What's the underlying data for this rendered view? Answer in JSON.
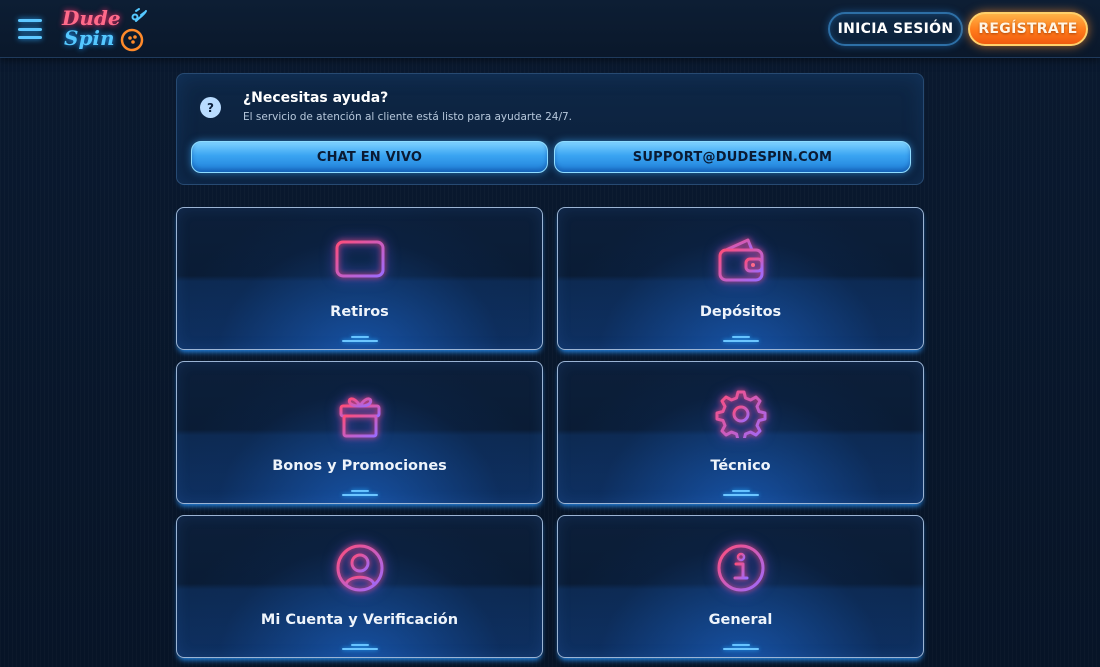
{
  "header": {
    "menu_icon": "hamburger-menu-icon",
    "logo": {
      "line1": "Dude",
      "line2": "Spin"
    },
    "login_label": "INICIA SESIÓN",
    "register_label": "REGÍSTRATE"
  },
  "help": {
    "icon": "question-icon",
    "title": "¿Necesitas ayuda?",
    "subtitle": "El servicio de atención al cliente está listo para ayudarte 24/7.",
    "chat_label": "CHAT EN VIVO",
    "email_label": "SUPPORT@DUDESPIN.COM"
  },
  "categories": [
    {
      "label": "Retiros",
      "icon": "credit-card-icon"
    },
    {
      "label": "Depósitos",
      "icon": "wallet-icon"
    },
    {
      "label": "Bonos y Promociones",
      "icon": "gift-icon"
    },
    {
      "label": "Técnico",
      "icon": "gear-icon"
    },
    {
      "label": "Mi Cuenta y Verificación",
      "icon": "user-profile-icon"
    },
    {
      "label": "General",
      "icon": "info-icon"
    }
  ],
  "colors": {
    "accent_blue": "#3aa4f2",
    "accent_orange": "#ff7a1a",
    "neon_pink": "#ff4d7a",
    "neon_violet": "#9a6bff",
    "background": "#071427"
  }
}
